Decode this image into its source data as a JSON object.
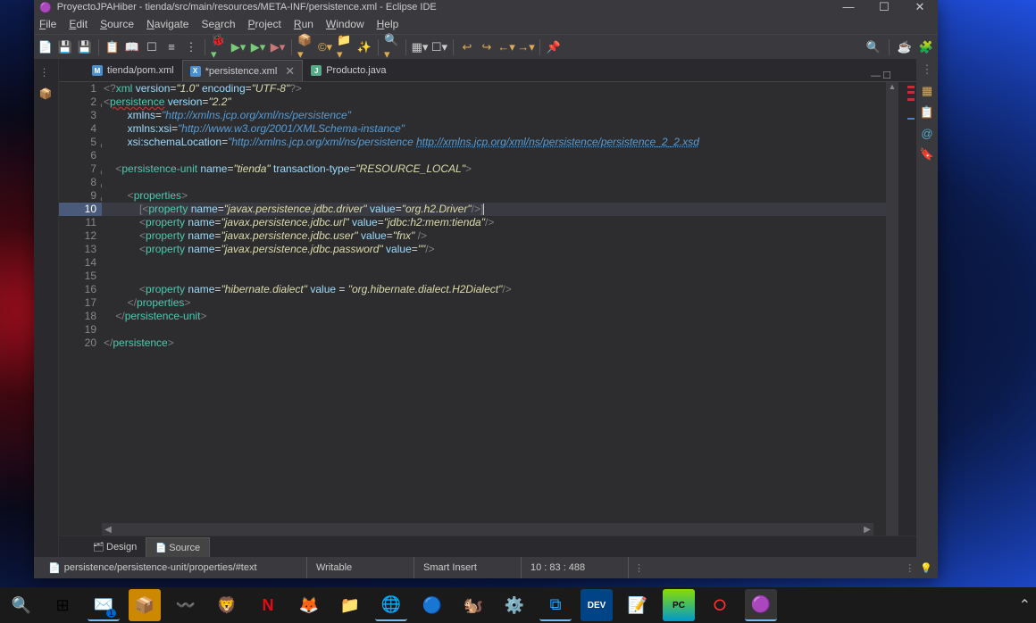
{
  "window": {
    "title": "ProyectoJPAHiber - tienda/src/main/resources/META-INF/persistence.xml - Eclipse IDE"
  },
  "menu": {
    "file": "File",
    "edit": "Edit",
    "source": "Source",
    "navigate": "Navigate",
    "search": "Search",
    "project": "Project",
    "run": "Run",
    "window": "Window",
    "help": "Help"
  },
  "tabs": {
    "t1": "tienda/pom.xml",
    "t2": "*persistence.xml",
    "t3": "Producto.java"
  },
  "code": {
    "l1_a": "<?",
    "l1_b": "xml",
    "l1_c": " version",
    "l1_d": "=",
    "l1_e": "\"1.0\"",
    "l1_f": " encoding",
    "l1_g": "=",
    "l1_h": "\"UTF-8\"",
    "l1_i": "?>",
    "l2_a": "<",
    "l2_b": "persistence",
    "l2_c": " version",
    "l2_d": "=",
    "l2_e": "\"2.2\"",
    "l3_a": "xmlns",
    "l3_b": "=",
    "l3_c": "\"http://xmlns.jcp.org/xml/ns/persistence\"",
    "l4_a": "xmlns:xsi",
    "l4_b": "=",
    "l4_c": "\"http://www.w3.org/2001/XMLSchema-instance\"",
    "l5_a": "xsi:schemaLocation",
    "l5_b": "=",
    "l5_c": "\"http://xmlns.jcp.org/xml/ns/persistence ",
    "l5_d": "http://xmlns.jcp.org/xml/ns/persistence/persistence_2_2.xsd",
    "l7_a": "<",
    "l7_b": "persistence-unit",
    "l7_c": " name",
    "l7_d": "=",
    "l7_e": "\"tienda\"",
    "l7_f": " transaction-type",
    "l7_g": "=",
    "l7_h": "\"RESOURCE_LOCAL\"",
    "l7_i": ">",
    "l9_a": "<",
    "l9_b": "properties",
    "l9_c": ">",
    "l10_a": "[<",
    "l10_b": "property",
    "l10_c": " name",
    "l10_d": "=",
    "l10_e": "\"javax.persistence.jdbc.driver\"",
    "l10_f": " value",
    "l10_g": "=",
    "l10_h": "\"org.h2.Driver\"",
    "l10_i": "/>]",
    "l11_a": "<",
    "l11_b": "property",
    "l11_c": " name",
    "l11_d": "=",
    "l11_e": "\"javax.persistence.jdbc.url\"",
    "l11_f": " value",
    "l11_g": "=",
    "l11_h": "\"jdbc:h2:mem:tienda\"",
    "l11_i": "/>",
    "l12_a": "<",
    "l12_b": "property",
    "l12_c": " name",
    "l12_d": "=",
    "l12_e": "\"javax.persistence.jdbc.user\"",
    "l12_f": " value",
    "l12_g": "=",
    "l12_h": "\"fnx\"",
    "l12_i": " />",
    "l13_a": "<",
    "l13_b": "property",
    "l13_c": " name",
    "l13_d": "=",
    "l13_e": "\"javax.persistence.jdbc.password\"",
    "l13_f": " value",
    "l13_g": "=",
    "l13_h": "\"\"",
    "l13_i": "/>",
    "l16_a": "<",
    "l16_b": "property",
    "l16_c": " name",
    "l16_d": "=",
    "l16_e": "\"hibernate.dialect\"",
    "l16_f": " value ",
    "l16_g": "= ",
    "l16_h": "\"org.hibernate.dialect.H2Dialect\"",
    "l16_i": "/>",
    "l17_a": "</",
    "l17_b": "properties",
    "l17_c": ">",
    "l18_a": "</",
    "l18_b": "persistence-unit",
    "l18_c": ">",
    "l20_a": "</",
    "l20_b": "persistence",
    "l20_c": ">"
  },
  "line_numbers": [
    "1",
    "2",
    "3",
    "4",
    "5",
    "6",
    "7",
    "8",
    "9",
    "10",
    "11",
    "12",
    "13",
    "14",
    "15",
    "16",
    "17",
    "18",
    "19",
    "20"
  ],
  "design_tabs": {
    "design": "Design",
    "source": "Source"
  },
  "status": {
    "breadcrumb": "persistence/persistence-unit/properties/#text",
    "writable": "Writable",
    "insert": "Smart Insert",
    "pos": "10 : 83 : 488"
  }
}
